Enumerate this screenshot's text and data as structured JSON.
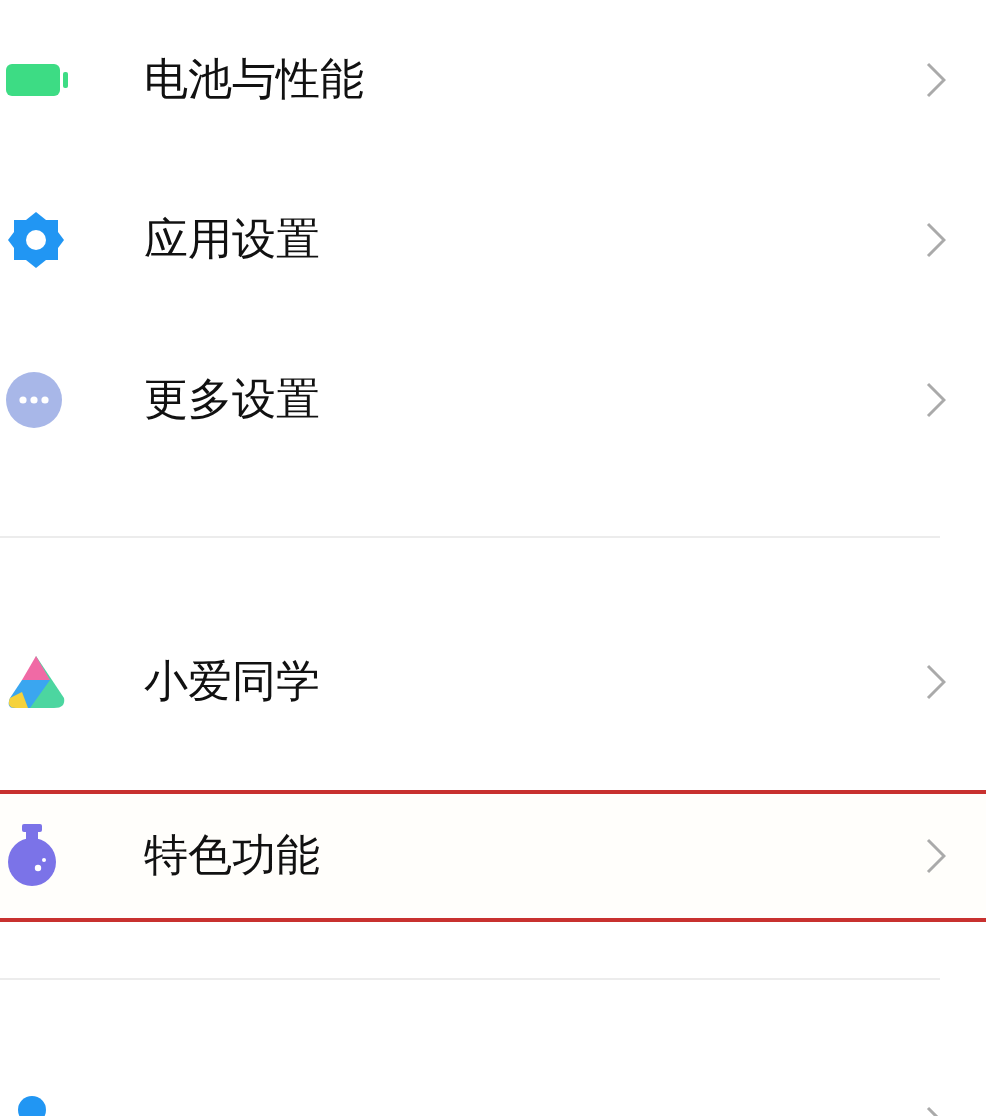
{
  "sections": [
    {
      "items": [
        {
          "label": "电池与性能",
          "highlighted": false
        },
        {
          "label": "应用设置",
          "highlighted": false
        },
        {
          "label": "更多设置",
          "highlighted": false
        }
      ]
    },
    {
      "items": [
        {
          "label": "小爱同学",
          "highlighted": false
        },
        {
          "label": "特色功能",
          "highlighted": true
        }
      ]
    },
    {
      "items": [
        {
          "highlighted": false
        }
      ]
    }
  ]
}
